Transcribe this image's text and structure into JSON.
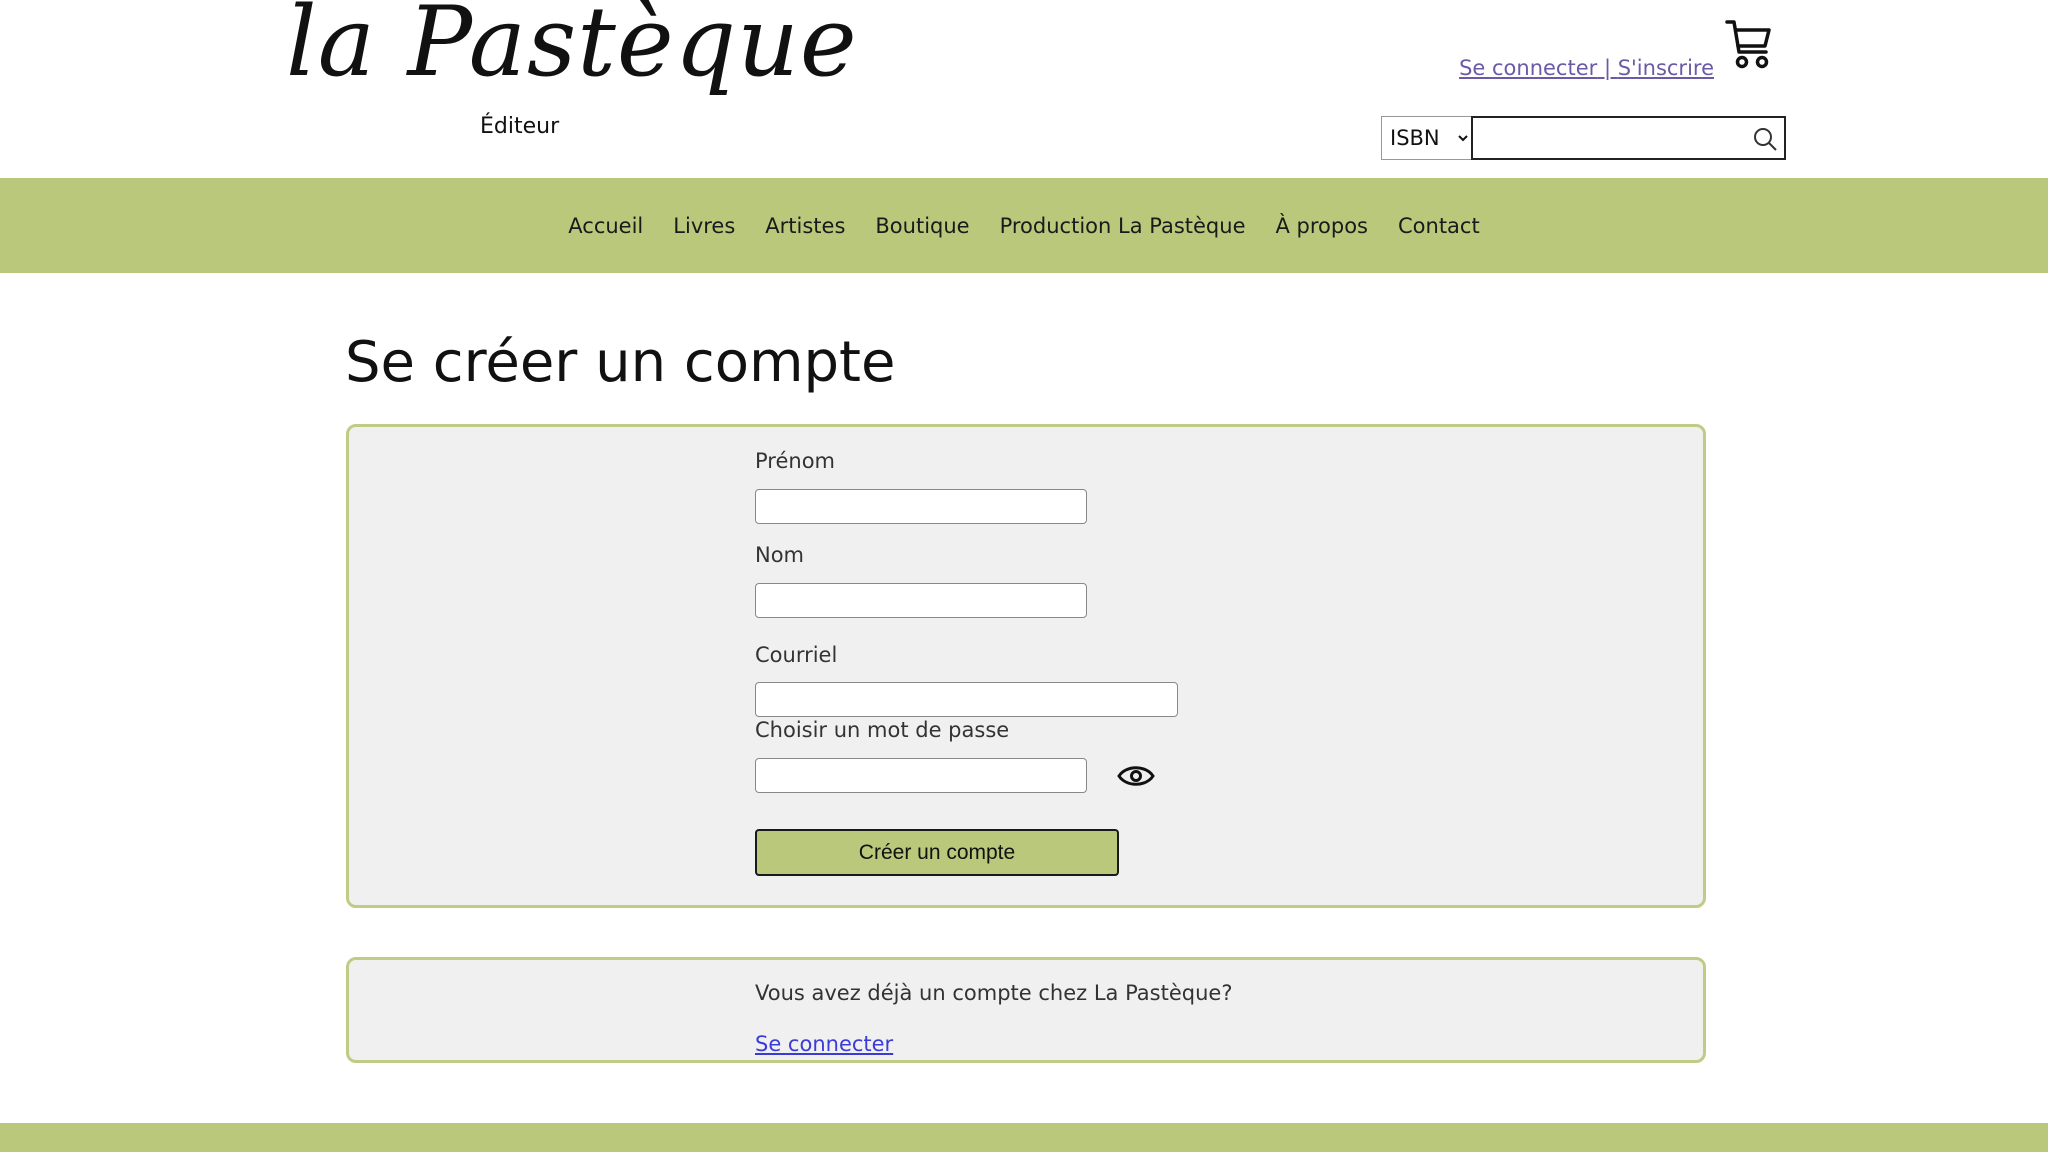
{
  "header": {
    "logo_text": "la Pastèque",
    "logo_subtitle": "Éditeur",
    "login_label": "Se connecter",
    "separator": " | ",
    "signup_label": "S'inscrire",
    "search": {
      "type_options": [
        "ISBN"
      ],
      "selected_type": "ISBN",
      "query_value": "",
      "query_placeholder": ""
    }
  },
  "nav": {
    "items": [
      {
        "label": "Accueil"
      },
      {
        "label": "Livres"
      },
      {
        "label": "Artistes"
      },
      {
        "label": "Boutique"
      },
      {
        "label": "Production La Pastèque"
      },
      {
        "label": "À propos"
      },
      {
        "label": "Contact"
      }
    ]
  },
  "page": {
    "title": "Se créer un compte"
  },
  "form": {
    "first_name_label": "Prénom",
    "first_name_value": "",
    "last_name_label": "Nom",
    "last_name_value": "",
    "email_label": "Courriel",
    "email_value": "",
    "password_label": "Choisir un mot de passe",
    "password_value": "",
    "submit_label": "Créer un compte"
  },
  "login_panel": {
    "text": "Vous avez déjà un compte chez La Pastèque?",
    "link_label": "Se connecter"
  },
  "colors": {
    "brand_green": "#b9c87b",
    "panel_border": "#bfcc86",
    "link_purple": "#6b5aa6",
    "link_blue": "#3b3bd8"
  },
  "icons": {
    "cart": "cart-icon",
    "search": "search-icon",
    "password_toggle": "eye-icon"
  }
}
